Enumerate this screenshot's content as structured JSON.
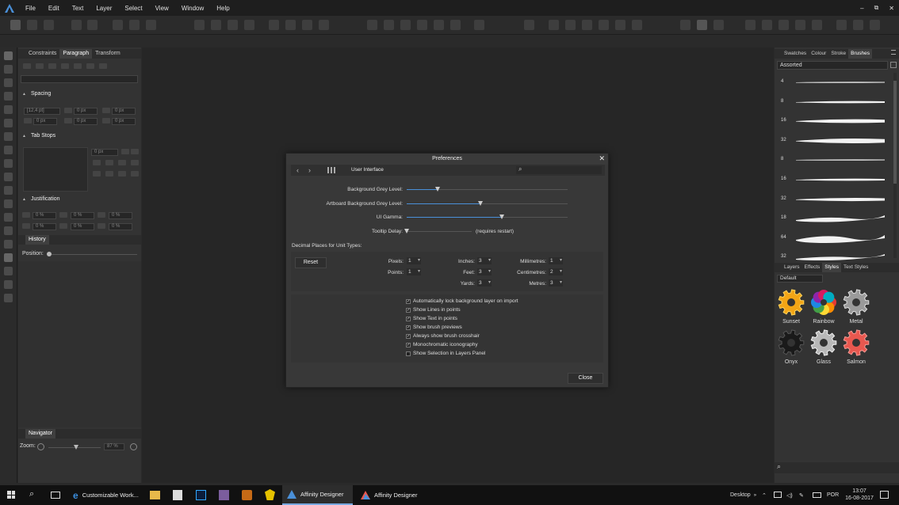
{
  "menubar": {
    "items": [
      "File",
      "Edit",
      "Text",
      "Layer",
      "Select",
      "View",
      "Window",
      "Help"
    ],
    "window_buttons": [
      "–",
      "⧉",
      "✕"
    ]
  },
  "left_panel": {
    "tabs": [
      "Constraints",
      "Paragraph",
      "Transform"
    ],
    "active_tab": "Paragraph",
    "spacing_label": "Spacing",
    "spacing_fields": [
      "[12,4 pt]",
      "0 px",
      "0 px",
      "0 px",
      "0 px",
      "0 px"
    ],
    "tabstops_label": "Tab Stops",
    "tabstop_value": "0 px",
    "justification_label": "Justification",
    "justification_fields": [
      "0 %",
      "0 %",
      "0 %",
      "0 %",
      "0 %",
      "0 %"
    ],
    "history_label": "History",
    "position_label": "Position:",
    "navigator_label": "Navigator",
    "zoom_label": "Zoom:",
    "zoom_value": "87 %"
  },
  "dialog": {
    "title": "Preferences",
    "close_icon": "✕",
    "section": "User Interface",
    "sliders": [
      {
        "label": "Background Grey Level:",
        "value": 0.19
      },
      {
        "label": "Artboard Background Grey Level:",
        "value": 0.46
      },
      {
        "label": "UI Gamma:",
        "value": 0.59
      },
      {
        "label": "Tooltip Delay:",
        "value": 0.0
      }
    ],
    "tooltip_note": "(requires restart)",
    "decimal_label": "Decimal Places for Unit Types:",
    "reset_label": "Reset",
    "units": [
      {
        "label": "Pixels:",
        "value": "1"
      },
      {
        "label": "Points:",
        "value": "1"
      },
      {
        "label": "Inches:",
        "value": "3"
      },
      {
        "label": "Feet:",
        "value": "3"
      },
      {
        "label": "Yards:",
        "value": "3"
      },
      {
        "label": "Millimetres:",
        "value": "1"
      },
      {
        "label": "Centimetres:",
        "value": "2"
      },
      {
        "label": "Metres:",
        "value": "3"
      }
    ],
    "checkboxes": [
      {
        "label": "Automatically lock background layer on import",
        "checked": true
      },
      {
        "label": "Show Lines in points",
        "checked": true
      },
      {
        "label": "Show Text in points",
        "checked": true
      },
      {
        "label": "Show brush previews",
        "checked": true
      },
      {
        "label": "Always show brush crosshair",
        "checked": true
      },
      {
        "label": "Monochromatic iconography",
        "checked": true
      },
      {
        "label": "Show Selection in Layers Panel",
        "checked": false
      }
    ],
    "close_label": "Close"
  },
  "right_panel": {
    "tabs": [
      "Swatches",
      "Colour",
      "Stroke",
      "Brushes"
    ],
    "active_tab": "Brushes",
    "category": "Assorted",
    "brush_sizes": [
      "4",
      "8",
      "16",
      "32",
      "8",
      "16",
      "32",
      "18",
      "64",
      "32"
    ],
    "lower_tabs": [
      "Layers",
      "Effects",
      "Styles",
      "Text Styles"
    ],
    "active_lower_tab": "Styles",
    "style_set": "Default",
    "styles": [
      "Sunset",
      "Rainbow",
      "Metal",
      "Onyx",
      "Glass",
      "Salmon"
    ]
  },
  "taskbar": {
    "tasks": [
      "Customizable Work...",
      "Affinity Designer",
      "Affinity Designer"
    ],
    "desktop_label": "Desktop",
    "lang": "POR",
    "time": "13:07",
    "date": "16-08-2017"
  },
  "colors": {
    "accent": "#4a90d9",
    "sunset": "#f2a516",
    "salmon": "#e8584f"
  }
}
